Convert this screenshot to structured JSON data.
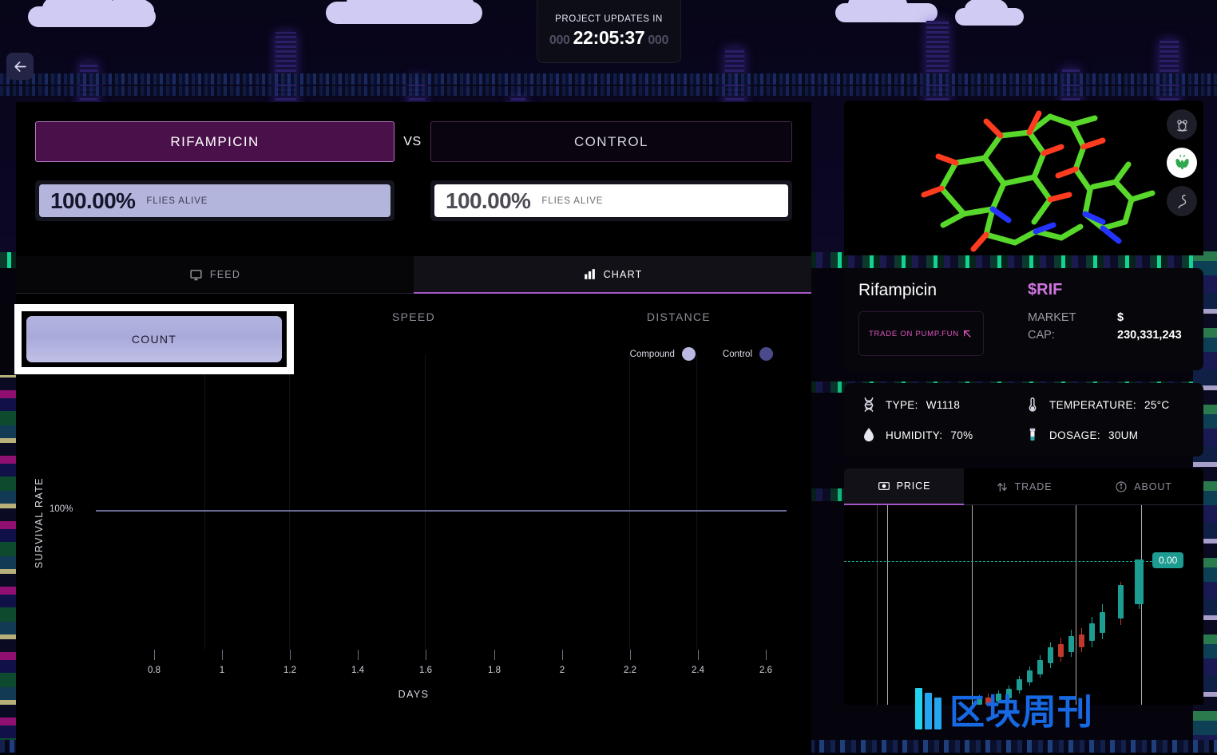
{
  "countdown": {
    "label": "PROJECT UPDATES IN",
    "prefix_ms": "000",
    "time": "22:05:37",
    "suffix_ms": "000"
  },
  "back_button": {
    "icon": "arrow-left-icon"
  },
  "comparison": {
    "compound_tab": "RIFAMPICIN",
    "vs": "VS",
    "control_tab": "CONTROL",
    "compound_stat": {
      "value": "100.00%",
      "label": "FLIES ALIVE",
      "percent": 100
    },
    "control_stat": {
      "value": "100.00%",
      "label": "FLIES ALIVE",
      "percent": 100
    }
  },
  "view_tabs": [
    {
      "label": "FEED",
      "icon": "monitor-icon",
      "active": false
    },
    {
      "label": "CHART",
      "icon": "bar-chart-icon",
      "active": true
    }
  ],
  "metric_tabs": [
    {
      "label": "COUNT",
      "active": true,
      "focused": true
    },
    {
      "label": "SPEED",
      "active": false,
      "focused": false
    },
    {
      "label": "DISTANCE",
      "active": false,
      "focused": false
    }
  ],
  "chart_data": {
    "type": "line",
    "title": "",
    "xlabel": "DAYS",
    "ylabel": "SURVIVAL RATE",
    "x_ticks": [
      "0.8",
      "1",
      "1.2",
      "1.4",
      "1.6",
      "1.8",
      "2",
      "2.2",
      "2.4",
      "2.6"
    ],
    "y_ticks": [
      "100%"
    ],
    "ylim": [
      0,
      100
    ],
    "xlim": [
      0.7,
      2.7
    ],
    "grid": true,
    "legend_position": "top-right",
    "legend": [
      {
        "name": "Compound",
        "color": "#b9b9e4"
      },
      {
        "name": "Control",
        "color": "#4a4a8c"
      }
    ],
    "series": [
      {
        "name": "Compound",
        "color": "#b9b9e4",
        "x": [
          0.8,
          1,
          1.2,
          1.4,
          1.6,
          1.8,
          2,
          2.2,
          2.4,
          2.6
        ],
        "values": [
          100,
          100,
          100,
          100,
          100,
          100,
          100,
          100,
          100,
          100
        ]
      },
      {
        "name": "Control",
        "color": "#4a4a8c",
        "x": [
          0.8,
          1,
          1.2,
          1.4,
          1.6,
          1.8,
          2,
          2.2,
          2.4,
          2.6
        ],
        "values": [
          100,
          100,
          100,
          100,
          100,
          100,
          100,
          100,
          100,
          100
        ]
      }
    ]
  },
  "molecule": {
    "name": "rifampicin-molecule",
    "buttons": [
      {
        "icon": "mouse-icon",
        "active": false
      },
      {
        "icon": "fly-icon",
        "active": true
      },
      {
        "icon": "worm-icon",
        "active": false
      }
    ]
  },
  "token": {
    "name": "Rifampicin",
    "ticker": "$RIF",
    "trade_label": "TRADE ON PUMP.FUN",
    "trade_icon": "arrow-up-left-icon",
    "market_cap_key_line1": "MARKET",
    "market_cap_key_line2": "CAP:",
    "market_cap_currency": "$",
    "market_cap_value": "230,331,243"
  },
  "specs": [
    {
      "icon": "dna-icon",
      "key": "TYPE:",
      "value": "W1118"
    },
    {
      "icon": "thermometer-icon",
      "key": "TEMPERATURE:",
      "value": "25°C"
    },
    {
      "icon": "droplet-icon",
      "key": "HUMIDITY:",
      "value": "70%"
    },
    {
      "icon": "vial-icon",
      "key": "DOSAGE:",
      "value": "30UM"
    }
  ],
  "price_tabs": [
    {
      "label": "PRICE",
      "icon": "price-tag-icon",
      "active": true
    },
    {
      "label": "TRADE",
      "icon": "swap-icon",
      "active": false
    },
    {
      "label": "ABOUT",
      "icon": "info-icon",
      "active": false
    }
  ],
  "price_chart": {
    "type": "candlestick",
    "last_price_label": "0.00",
    "up_color": "#1d9c92",
    "down_color": "#c0392b"
  },
  "watermark": {
    "text": "区块周刊"
  },
  "colors": {
    "accent_purple": "#a557c9",
    "ticker_pink": "#cf74e0",
    "compound_lavender": "#b4b5dd",
    "teal": "#1d9c92"
  }
}
